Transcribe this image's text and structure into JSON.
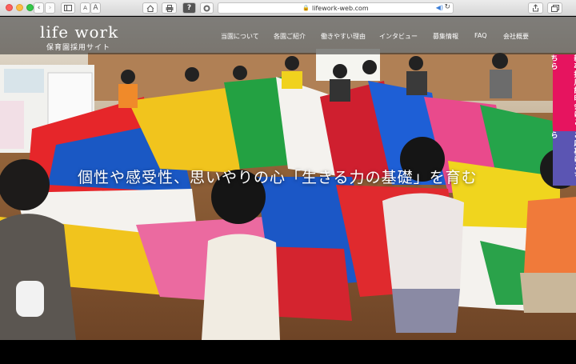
{
  "browser": {
    "url": "lifework-web.com",
    "font_small_label": "A",
    "font_large_label": "A",
    "icons": [
      "back-icon",
      "forward-icon",
      "sidebar-icon",
      "home-icon",
      "print-icon",
      "help-icon",
      "extension-icon",
      "lock-icon",
      "speaker-icon",
      "reload-icon",
      "share-icon",
      "tabs-icon"
    ]
  },
  "site": {
    "title": "life work",
    "subtitle": "保育園採用サイト",
    "nav": [
      {
        "label": "当園について"
      },
      {
        "label": "各園ご紹介"
      },
      {
        "label": "働きやすい理由"
      },
      {
        "label": "インタビュー"
      },
      {
        "label": "募集情報"
      },
      {
        "label": "FAQ"
      },
      {
        "label": "会社概要"
      }
    ],
    "catchcopy": "個性や感受性、思いやりの心「生きる力の基礎」を育む",
    "side_tabs": [
      {
        "label": "新卒採用説明会はこちら",
        "color": "#e6145f"
      },
      {
        "label": "ご応募はこちら",
        "color": "#5b55b3"
      }
    ]
  }
}
